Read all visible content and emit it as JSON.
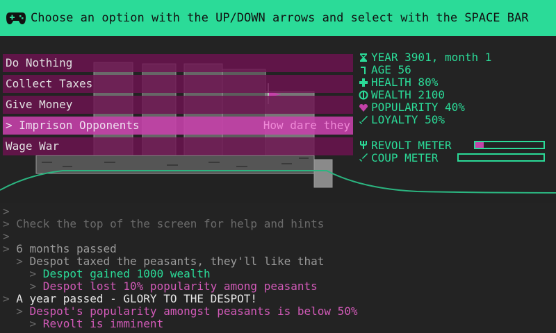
{
  "header": {
    "icon": "gamepad-icon",
    "instruction": "Choose an option with the UP/DOWN arrows and select with the SPACE BAR"
  },
  "menu": {
    "items": [
      {
        "label": "Do Nothing",
        "hint": ""
      },
      {
        "label": "Collect Taxes",
        "hint": ""
      },
      {
        "label": "Give Money",
        "hint": ""
      },
      {
        "label": "> Imprison Opponents",
        "hint": "How dare they",
        "selected": true
      },
      {
        "label": "Wage War",
        "hint": ""
      }
    ]
  },
  "stats": {
    "year": "YEAR 3901, month 1",
    "age": "AGE 56",
    "health": "HEALTH 80%",
    "wealth": "WEALTH 2100",
    "popularity": "POPULARITY 40%",
    "loyalty": "LOYALTY 50%"
  },
  "meters": {
    "revolt_label": "REVOLT METER",
    "revolt_level": 0.12,
    "coup_label": "COUP METER",
    "coup_level": 0.0
  },
  "log": {
    "lines": [
      {
        "prefix": ">",
        "text": "",
        "color": "grey"
      },
      {
        "prefix": ">",
        "text": " Check the top of the screen for help and hints",
        "color": "grey"
      },
      {
        "prefix": ">",
        "text": "",
        "color": "grey"
      },
      {
        "prefix": ">",
        "text": " 6 months passed",
        "color": "lgrey"
      },
      {
        "prefix": "  >",
        "text": " Despot taxed the peasants, they'll like that",
        "color": "lgrey"
      },
      {
        "prefix": "    >",
        "text": " Despot gained 1000 wealth",
        "color": "green"
      },
      {
        "prefix": "    >",
        "text": " Despot lost 10% popularity among peasants",
        "color": "pink"
      },
      {
        "prefix": ">",
        "text": " A year passed - GLORY TO THE DESPOT!",
        "color": "white"
      },
      {
        "prefix": "  >",
        "text": " Despot's popularity amongst peasants is below 50%",
        "color": "pink"
      },
      {
        "prefix": "    >",
        "text": " Revolt is imminent",
        "color": "pink"
      }
    ]
  },
  "colors": {
    "accent": "#2bdb98",
    "menu_bg": "#6e1250",
    "menu_selected": "#c441a8",
    "background": "#232323"
  }
}
